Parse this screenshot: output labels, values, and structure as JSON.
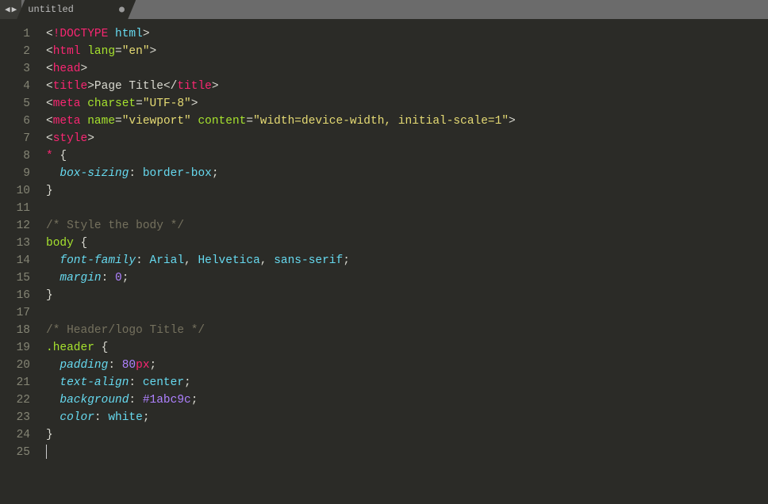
{
  "tab": {
    "title": "untitled",
    "dirty": true
  },
  "lineCount": 25,
  "code": {
    "l1": [
      [
        "<",
        "c-punct"
      ],
      [
        "!",
        "c-excl"
      ],
      [
        "DOCTYPE",
        "c-doctype"
      ],
      [
        " ",
        "c-punct"
      ],
      [
        "html",
        "c-dthtml"
      ],
      [
        ">",
        "c-punct"
      ]
    ],
    "l2": [
      [
        "<",
        "c-punct"
      ],
      [
        "html",
        "c-tag"
      ],
      [
        " ",
        "c-punct"
      ],
      [
        "lang",
        "c-attr"
      ],
      [
        "=",
        "c-punct"
      ],
      [
        "\"en\"",
        "c-str"
      ],
      [
        ">",
        "c-punct"
      ]
    ],
    "l3": [
      [
        "<",
        "c-punct"
      ],
      [
        "head",
        "c-tag"
      ],
      [
        ">",
        "c-punct"
      ]
    ],
    "l4": [
      [
        "<",
        "c-punct"
      ],
      [
        "title",
        "c-tag"
      ],
      [
        ">",
        "c-punct"
      ],
      [
        "Page Title",
        "c-text"
      ],
      [
        "</",
        "c-punct"
      ],
      [
        "title",
        "c-tag"
      ],
      [
        ">",
        "c-punct"
      ]
    ],
    "l5": [
      [
        "<",
        "c-punct"
      ],
      [
        "meta",
        "c-tag"
      ],
      [
        " ",
        "c-punct"
      ],
      [
        "charset",
        "c-attr"
      ],
      [
        "=",
        "c-punct"
      ],
      [
        "\"UTF-8\"",
        "c-str"
      ],
      [
        ">",
        "c-punct"
      ]
    ],
    "l6": [
      [
        "<",
        "c-punct"
      ],
      [
        "meta",
        "c-tag"
      ],
      [
        " ",
        "c-punct"
      ],
      [
        "name",
        "c-attr"
      ],
      [
        "=",
        "c-punct"
      ],
      [
        "\"viewport\"",
        "c-str"
      ],
      [
        " ",
        "c-punct"
      ],
      [
        "content",
        "c-attr"
      ],
      [
        "=",
        "c-punct"
      ],
      [
        "\"width=device-width, initial-scale=1\"",
        "c-str"
      ],
      [
        ">",
        "c-punct"
      ]
    ],
    "l7": [
      [
        "<",
        "c-punct"
      ],
      [
        "style",
        "c-tag"
      ],
      [
        ">",
        "c-punct"
      ]
    ],
    "l8": [
      [
        "*",
        "c-star"
      ],
      [
        " {",
        "c-punct"
      ]
    ],
    "l9": [
      [
        "  ",
        "c-punct"
      ],
      [
        "box-sizing",
        "c-prop"
      ],
      [
        ": ",
        "c-punct"
      ],
      [
        "border-box",
        "c-val"
      ],
      [
        ";",
        "c-punct"
      ]
    ],
    "l10": [
      [
        "}",
        "c-punct"
      ]
    ],
    "l11": [
      [
        "",
        "c-punct"
      ]
    ],
    "l12": [
      [
        "/* Style the body */",
        "c-comment"
      ]
    ],
    "l13": [
      [
        "body",
        "c-sel"
      ],
      [
        " {",
        "c-punct"
      ]
    ],
    "l14": [
      [
        "  ",
        "c-punct"
      ],
      [
        "font-family",
        "c-prop"
      ],
      [
        ": ",
        "c-punct"
      ],
      [
        "Arial",
        "c-val"
      ],
      [
        ", ",
        "c-punct"
      ],
      [
        "Helvetica",
        "c-val"
      ],
      [
        ", ",
        "c-punct"
      ],
      [
        "sans-serif",
        "c-val"
      ],
      [
        ";",
        "c-punct"
      ]
    ],
    "l15": [
      [
        "  ",
        "c-punct"
      ],
      [
        "margin",
        "c-prop"
      ],
      [
        ": ",
        "c-punct"
      ],
      [
        "0",
        "c-num"
      ],
      [
        ";",
        "c-punct"
      ]
    ],
    "l16": [
      [
        "}",
        "c-punct"
      ]
    ],
    "l17": [
      [
        "",
        "c-punct"
      ]
    ],
    "l18": [
      [
        "/* Header/logo Title */",
        "c-comment"
      ]
    ],
    "l19": [
      [
        ".header",
        "c-sel"
      ],
      [
        " {",
        "c-punct"
      ]
    ],
    "l20": [
      [
        "  ",
        "c-punct"
      ],
      [
        "padding",
        "c-prop"
      ],
      [
        ": ",
        "c-punct"
      ],
      [
        "80",
        "c-num"
      ],
      [
        "px",
        "c-unit"
      ],
      [
        ";",
        "c-punct"
      ]
    ],
    "l21": [
      [
        "  ",
        "c-punct"
      ],
      [
        "text-align",
        "c-prop"
      ],
      [
        ": ",
        "c-punct"
      ],
      [
        "center",
        "c-val"
      ],
      [
        ";",
        "c-punct"
      ]
    ],
    "l22": [
      [
        "  ",
        "c-punct"
      ],
      [
        "background",
        "c-prop"
      ],
      [
        ": ",
        "c-punct"
      ],
      [
        "#1abc9c",
        "c-num"
      ],
      [
        ";",
        "c-punct"
      ]
    ],
    "l23": [
      [
        "  ",
        "c-punct"
      ],
      [
        "color",
        "c-prop"
      ],
      [
        ": ",
        "c-punct"
      ],
      [
        "white",
        "c-val"
      ],
      [
        ";",
        "c-punct"
      ]
    ],
    "l24": [
      [
        "}",
        "c-punct"
      ]
    ],
    "l25": [
      [
        "",
        "c-punct"
      ]
    ]
  },
  "cursorLine": 25
}
